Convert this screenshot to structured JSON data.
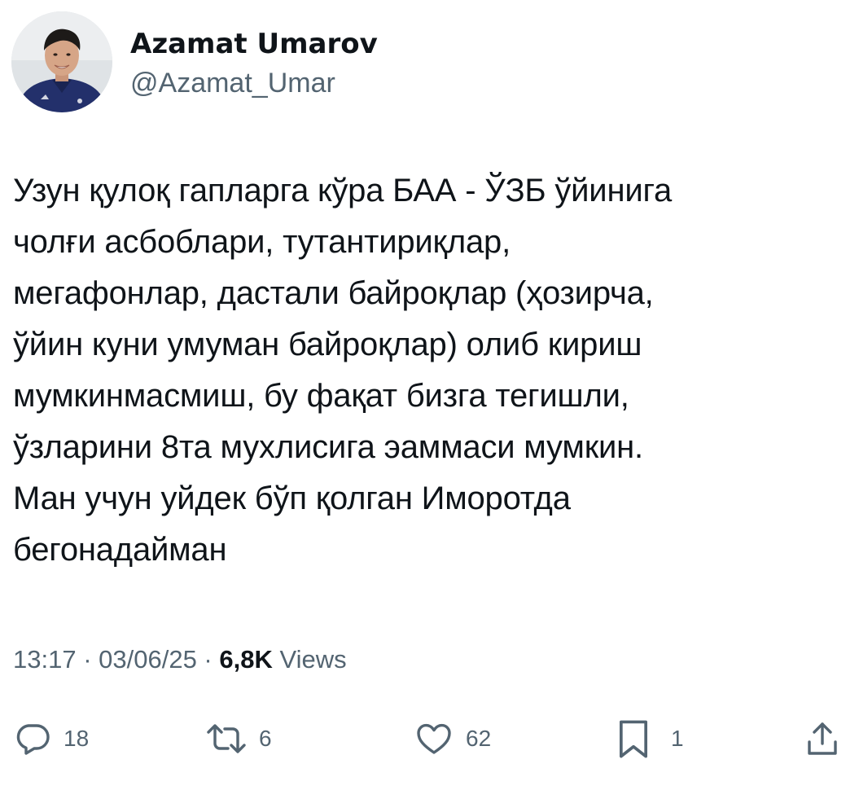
{
  "author": {
    "display_name": "Azamat Umarov",
    "handle": "@Azamat_Umar"
  },
  "tweet": {
    "text": "Узун қулоқ гапларга кўра БАА - ЎЗБ ўйинига\nчолғи асбоблари, тутантириқлар,\nмегафонлар, дастали байроқлар (ҳозирча,\nўйин куни умуман байроқлар) олиб кириш\nмумкинмасмиш, бу фақат бизга тегишли,\nўзларини 8та мухлисига эаммаси мумкин.\nМан учун уйдек бўп қолган Иморотда\nбегонадайман"
  },
  "meta": {
    "time": "13:17",
    "separator_1": " · ",
    "date": "03/06/25",
    "separator_2": " · ",
    "views_count": "6,8K",
    "views_label": "Views"
  },
  "actions": {
    "replies": {
      "icon": "reply-icon",
      "count": "18"
    },
    "retweets": {
      "icon": "retweet-icon",
      "count": "6"
    },
    "likes": {
      "icon": "heart-icon",
      "count": "62"
    },
    "bookmarks": {
      "icon": "bookmark-icon",
      "count": "1"
    },
    "share": {
      "icon": "share-icon"
    }
  },
  "colors": {
    "text_primary": "#0f1419",
    "text_secondary": "#536471",
    "background": "#ffffff"
  }
}
